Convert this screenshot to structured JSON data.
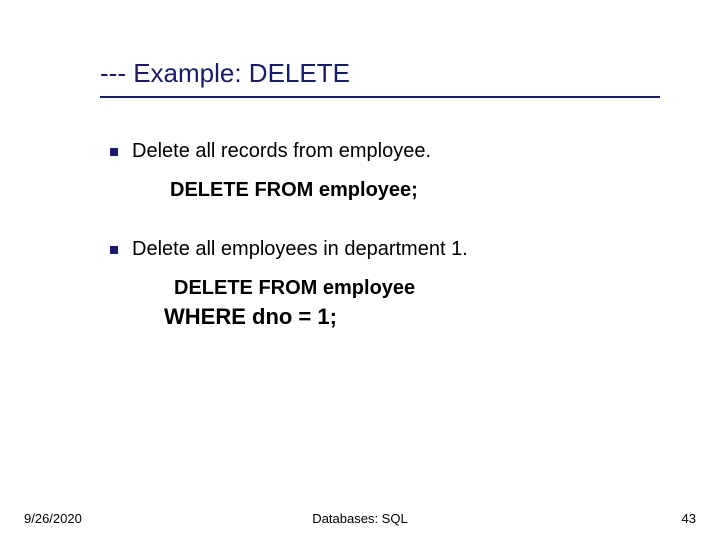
{
  "title": "--- Example: DELETE",
  "bullets": [
    {
      "text": "Delete all records from employee.",
      "code": [
        "DELETE FROM employee;"
      ]
    },
    {
      "text": "Delete all employees in department 1.",
      "code": [
        "DELETE FROM employee",
        "WHERE dno = 1;"
      ]
    }
  ],
  "footer": {
    "date": "9/26/2020",
    "center": "Databases: SQL",
    "page": "43"
  }
}
